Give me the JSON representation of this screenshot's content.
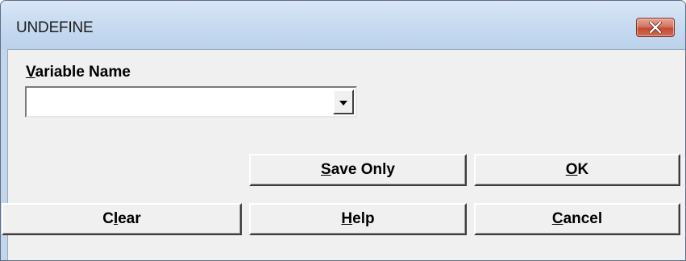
{
  "window": {
    "title": "UNDEFINE",
    "close_icon": "close-x-icon"
  },
  "form": {
    "variable_label_first": "V",
    "variable_label_rest": "ariable Name",
    "variable_value": ""
  },
  "buttons": {
    "save_only": {
      "before": "",
      "mnemonic": "S",
      "after": "ave Only"
    },
    "ok": {
      "before": "",
      "mnemonic": "O",
      "after": "K"
    },
    "clear": {
      "before": "C",
      "mnemonic": "l",
      "after": "ear"
    },
    "help": {
      "before": "",
      "mnemonic": "H",
      "after": "elp"
    },
    "cancel": {
      "before": "",
      "mnemonic": "C",
      "after": "ancel"
    }
  },
  "colors": {
    "close_button": "#c44b33",
    "titlebar": "#c7daf0",
    "client": "#f0f0f0"
  }
}
